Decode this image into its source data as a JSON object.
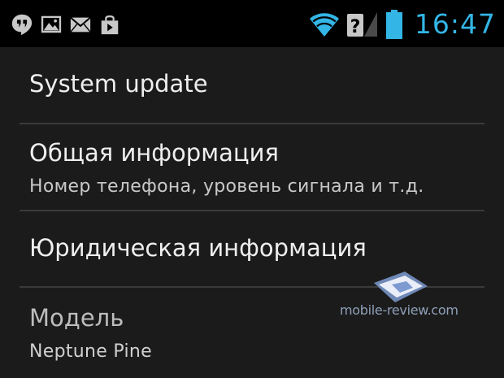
{
  "status_bar": {
    "time": "16:47",
    "accent_color": "#33b5e5",
    "left_icons": [
      "hangouts-icon",
      "gallery-icon",
      "mail-icon",
      "shopping-bag-icon"
    ],
    "right_icons": [
      "wifi-icon",
      "no-sim-icon",
      "battery-icon"
    ]
  },
  "settings_list": {
    "items": [
      {
        "title": "System update"
      },
      {
        "title": "Общая информация",
        "summary": "Номер телефона, уровень сигнала и т.д."
      },
      {
        "title": "Юридическая информация"
      },
      {
        "title": "Модель",
        "summary": "Neptune Pine"
      }
    ]
  },
  "watermark": {
    "text": "mobile-review.com"
  }
}
